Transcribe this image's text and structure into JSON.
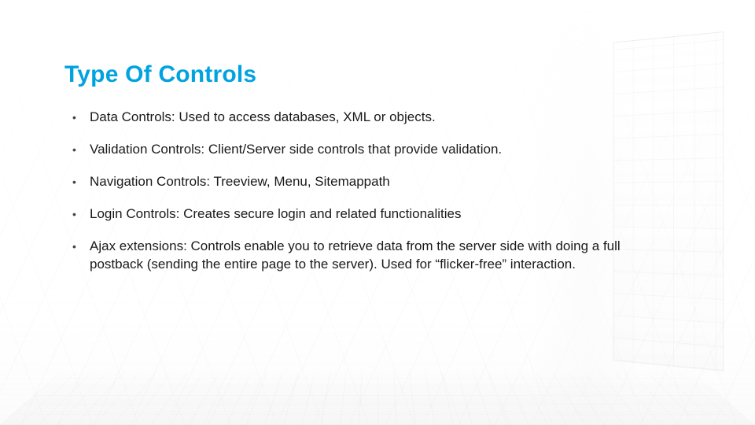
{
  "slide": {
    "title": "Type Of Controls",
    "bullets": [
      "Data Controls: Used to access databases, XML or objects.",
      "Validation Controls:  Client/Server side controls that provide validation.",
      "Navigation Controls: Treeview, Menu, Sitemappath",
      "Login Controls: Creates secure login and related functionalities",
      "Ajax extensions: Controls enable you to retrieve data from the server side with doing a full postback (sending the entire page to the server). Used for “flicker-free” interaction."
    ]
  },
  "colors": {
    "title": "#00A3E0",
    "text": "#1a1a1a"
  }
}
